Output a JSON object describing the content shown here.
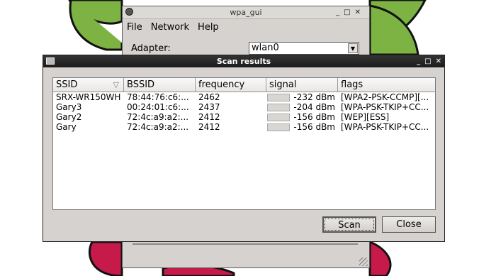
{
  "colors": {
    "wallpaper_green": "#7cb342",
    "wallpaper_red": "#c51a4a",
    "window_bg": "#d6d2d0",
    "titlebar_dark": "#222222"
  },
  "wpa_gui": {
    "title": "wpa_gui",
    "menu": [
      "File",
      "Network",
      "Help"
    ],
    "adapter_label": "Adapter:",
    "adapter_value": "wlan0"
  },
  "scan": {
    "title": "Scan results",
    "columns": [
      "SSID",
      "BSSID",
      "frequency",
      "signal",
      "flags"
    ],
    "rows": [
      {
        "ssid": "SRX-WR150WH",
        "bssid": "78:44:76:c6:...",
        "frequency": "2462",
        "signal": "-232 dBm",
        "flags": "[WPA2-PSK-CCMP][..."
      },
      {
        "ssid": "Gary3",
        "bssid": "00:24:01:c6:...",
        "frequency": "2437",
        "signal": "-204 dBm",
        "flags": "[WPA-PSK-TKIP+CC..."
      },
      {
        "ssid": "Gary2",
        "bssid": "72:4c:a9:a2:...",
        "frequency": "2412",
        "signal": "-156 dBm",
        "flags": "[WEP][ESS]"
      },
      {
        "ssid": "Gary",
        "bssid": "72:4c:a9:a2:...",
        "frequency": "2412",
        "signal": "-156 dBm",
        "flags": "[WPA-PSK-TKIP+CC..."
      }
    ],
    "scan_button": "Scan",
    "close_button": "Close"
  }
}
